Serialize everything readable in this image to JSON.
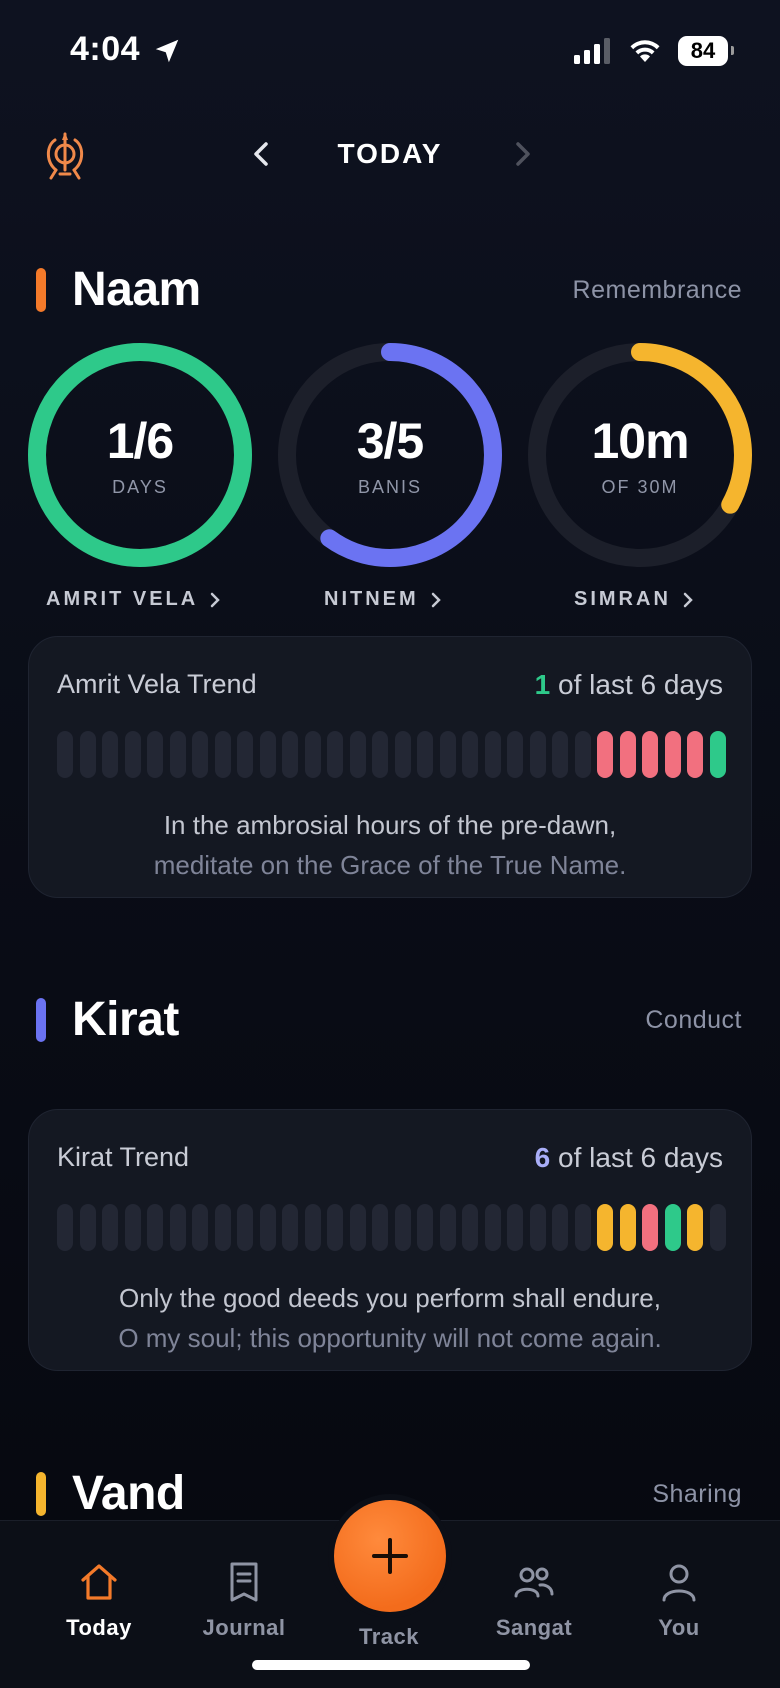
{
  "status_bar": {
    "time": "4:04",
    "battery": "84"
  },
  "header": {
    "title": "TODAY"
  },
  "naam": {
    "title": "Naam",
    "subtitle": "Remembrance",
    "accent": "#f47a2a",
    "rings": [
      {
        "value": "1/6",
        "unit": "DAYS",
        "label": "AMRIT VELA",
        "color": "#2ec98a",
        "progress": 1.0
      },
      {
        "value": "3/5",
        "unit": "BANIS",
        "label": "NITNEM",
        "color": "#6b73f2",
        "progress": 0.6
      },
      {
        "value": "10m",
        "unit": "OF 30M",
        "label": "SIMRAN",
        "color": "#f5b52e",
        "progress": 0.33
      }
    ],
    "trend": {
      "title": "Amrit Vela Trend",
      "count": "1",
      "count_suffix": "of last 6 days",
      "count_color": "#2ec98a",
      "bars": [
        "empty",
        "empty",
        "empty",
        "empty",
        "empty",
        "empty",
        "empty",
        "empty",
        "empty",
        "empty",
        "empty",
        "empty",
        "empty",
        "empty",
        "empty",
        "empty",
        "empty",
        "empty",
        "empty",
        "empty",
        "empty",
        "empty",
        "empty",
        "empty",
        "red",
        "red",
        "red",
        "red",
        "red",
        "green"
      ],
      "quote_line1": "In the ambrosial hours of the pre-dawn,",
      "quote_line2": "meditate on the Grace of the True Name."
    }
  },
  "kirat": {
    "title": "Kirat",
    "subtitle": "Conduct",
    "accent": "#6b73f2",
    "trend": {
      "title": "Kirat Trend",
      "count": "6",
      "count_suffix": "of last 6 days",
      "count_color": "#a9aef8",
      "bars": [
        "empty",
        "empty",
        "empty",
        "empty",
        "empty",
        "empty",
        "empty",
        "empty",
        "empty",
        "empty",
        "empty",
        "empty",
        "empty",
        "empty",
        "empty",
        "empty",
        "empty",
        "empty",
        "empty",
        "empty",
        "empty",
        "empty",
        "empty",
        "empty",
        "yellow",
        "yellow",
        "red",
        "green",
        "yellow",
        "empty"
      ],
      "quote_line1": "Only the good deeds you perform shall endure,",
      "quote_line2": "O my soul; this opportunity will not come again."
    }
  },
  "vand": {
    "title": "Vand",
    "subtitle": "Sharing",
    "accent": "#f5b52e"
  },
  "bar_colors": {
    "empty": "#232734",
    "red": "#f2707f",
    "green": "#2ec98a",
    "yellow": "#f5b52e"
  },
  "tabs": [
    {
      "label": "Today",
      "icon": "home-icon",
      "active": true
    },
    {
      "label": "Journal",
      "icon": "journal-icon",
      "active": false
    },
    {
      "label": "Track",
      "icon": "plus-icon",
      "active": false
    },
    {
      "label": "Sangat",
      "icon": "people-icon",
      "active": false
    },
    {
      "label": "You",
      "icon": "person-icon",
      "active": false
    }
  ]
}
